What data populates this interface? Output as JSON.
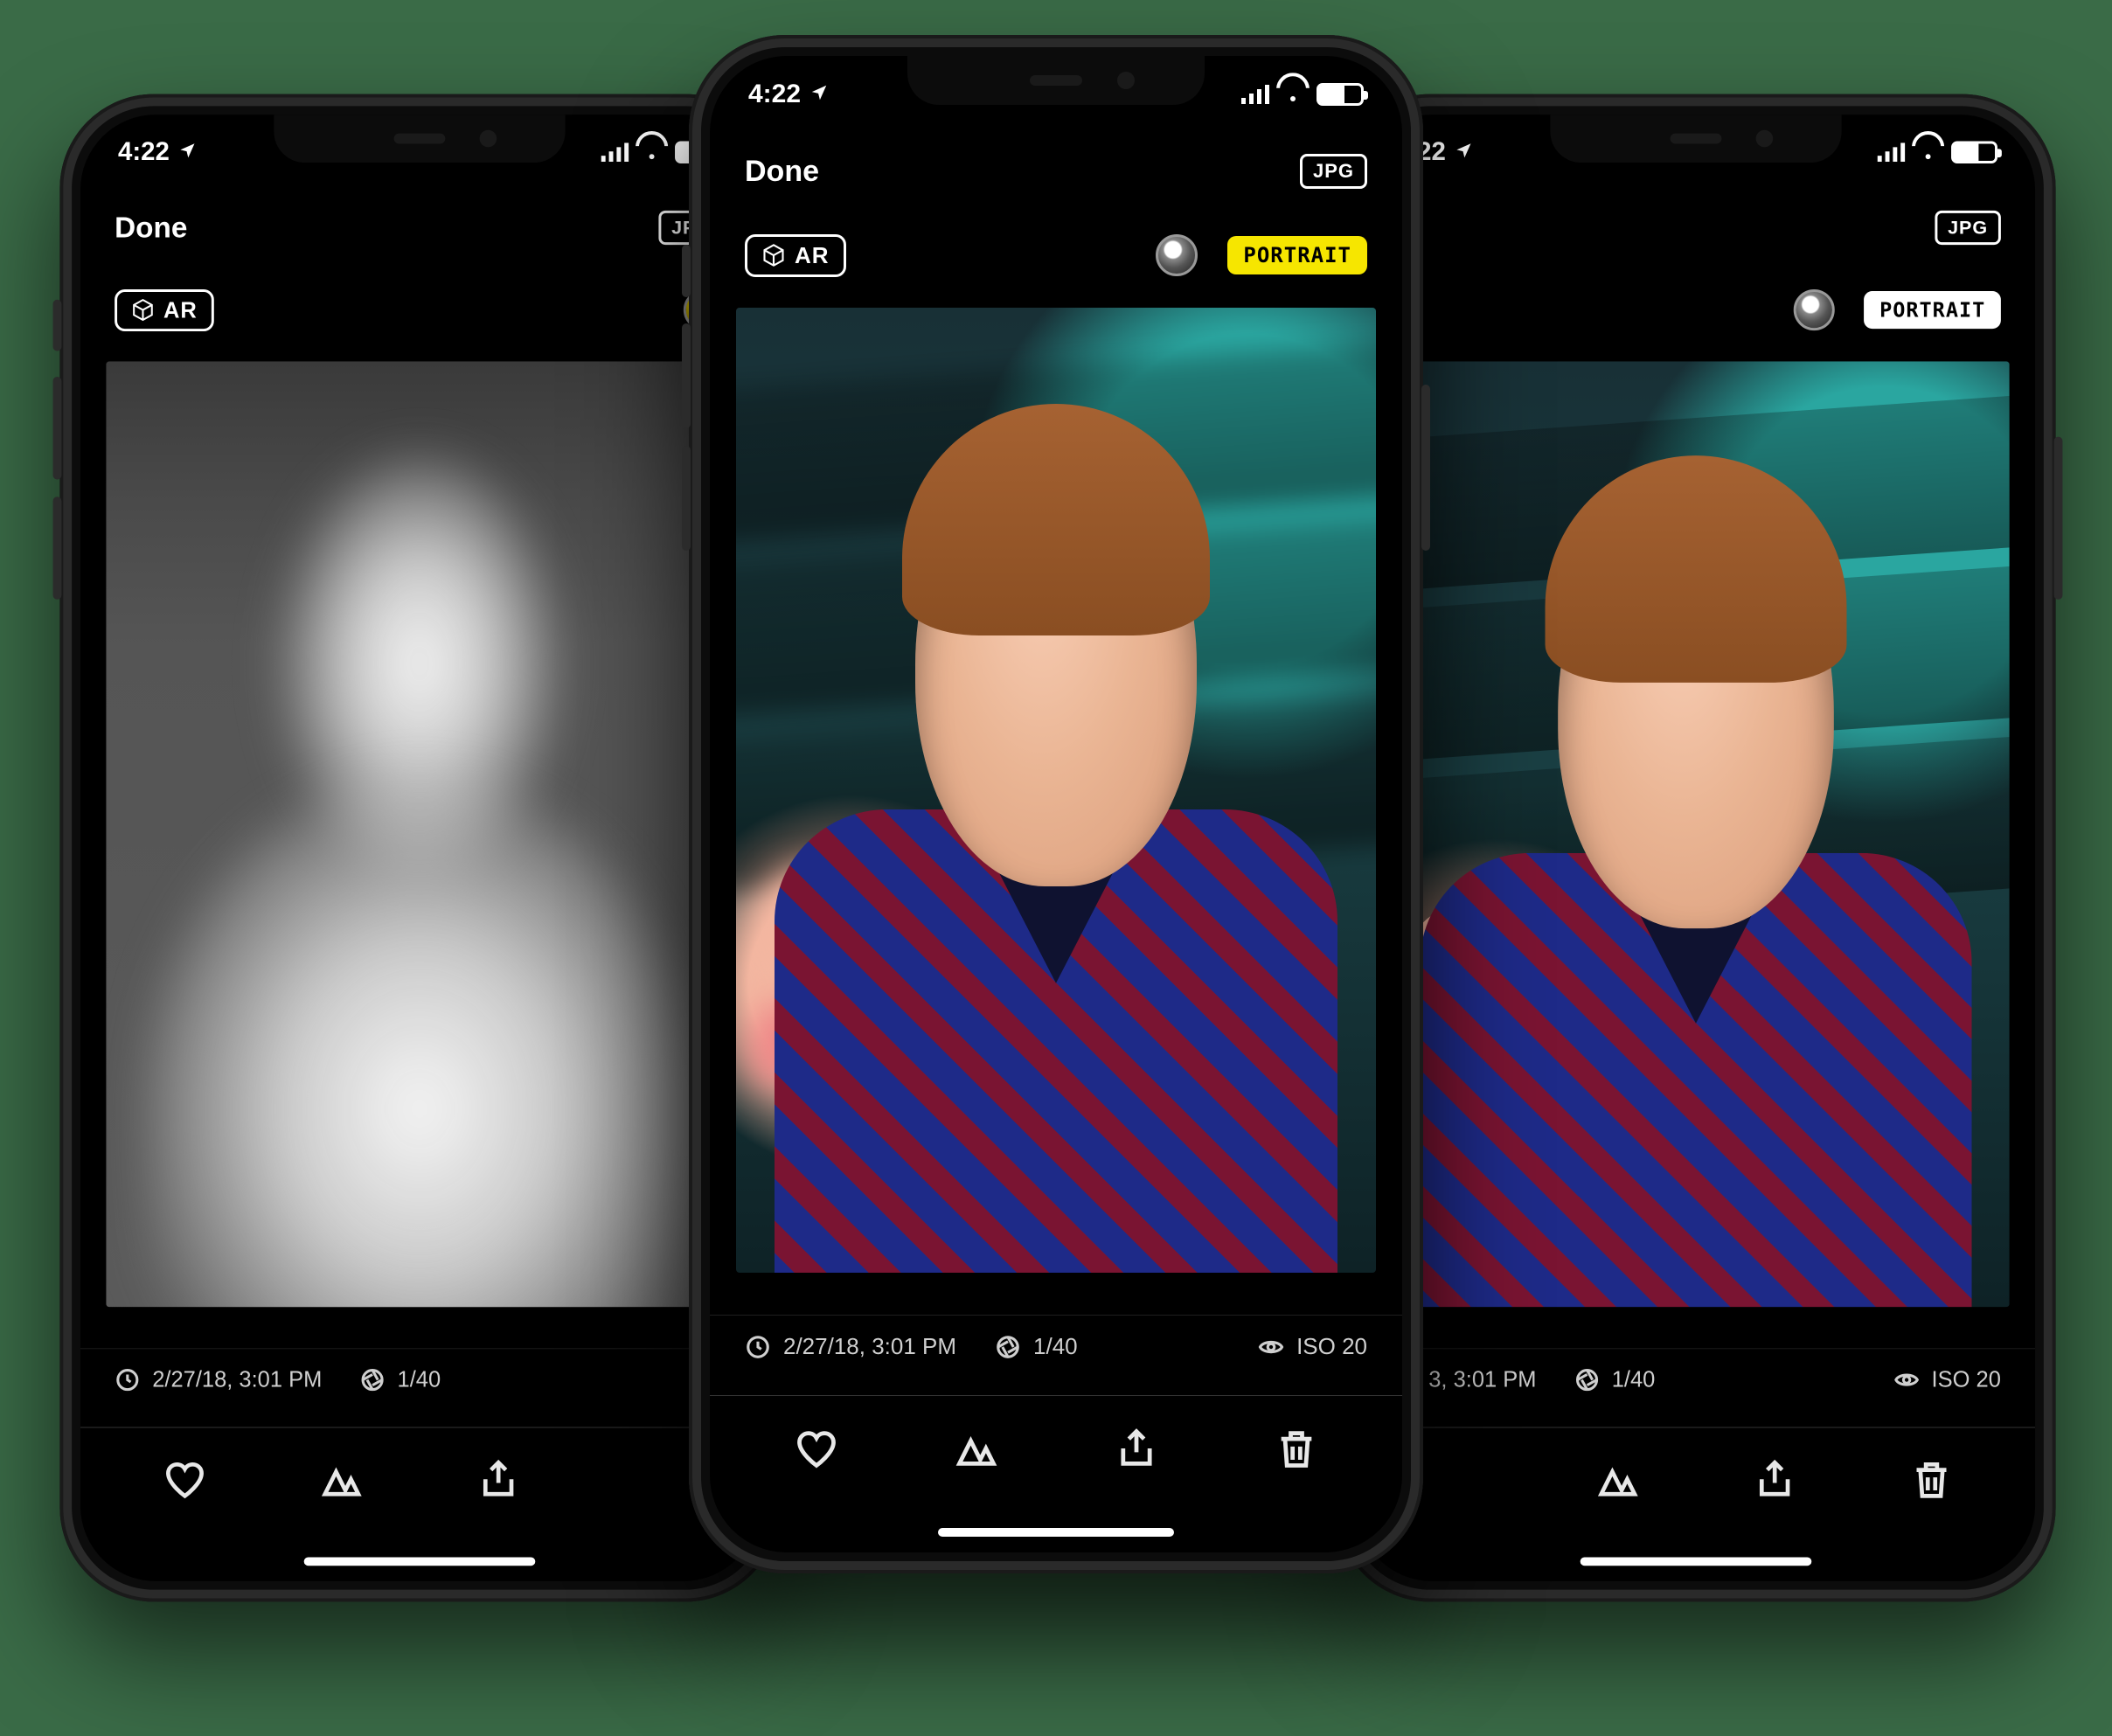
{
  "status": {
    "time": "4:22",
    "location_icon": "location-arrow",
    "signal_icon": "cellular-signal",
    "wifi_icon": "wifi",
    "battery_icon": "battery"
  },
  "nav": {
    "done": "Done",
    "format_badge": "JPG"
  },
  "mode": {
    "ar_label": "AR",
    "ar_icon": "cube-3d",
    "aperture_icon": "aperture-dot",
    "portrait_label": "PORTRAIT"
  },
  "meta": {
    "clock_icon": "clock",
    "timestamp": "2/27/18, 3:01 PM",
    "aperture_icon": "aperture",
    "shutter": "1/40",
    "iso_icon": "eye",
    "iso": "ISO 20",
    "ts_short": "3, 3:01 PM"
  },
  "toolbar": {
    "favorite_icon": "heart",
    "filters_icon": "mountains",
    "share_icon": "share",
    "delete_icon": "trash"
  },
  "phones": {
    "left": {
      "variant": "depth",
      "aperture_tint": "yellow",
      "show_portrait_pill": false,
      "show_iso": false
    },
    "center": {
      "variant": "portrait",
      "aperture_tint": "gray",
      "show_portrait_pill": true,
      "pill_style": "yellow",
      "show_iso": true
    },
    "right": {
      "variant": "original",
      "aperture_tint": "gray",
      "show_portrait_pill": true,
      "pill_style": "white",
      "show_iso": true
    }
  }
}
